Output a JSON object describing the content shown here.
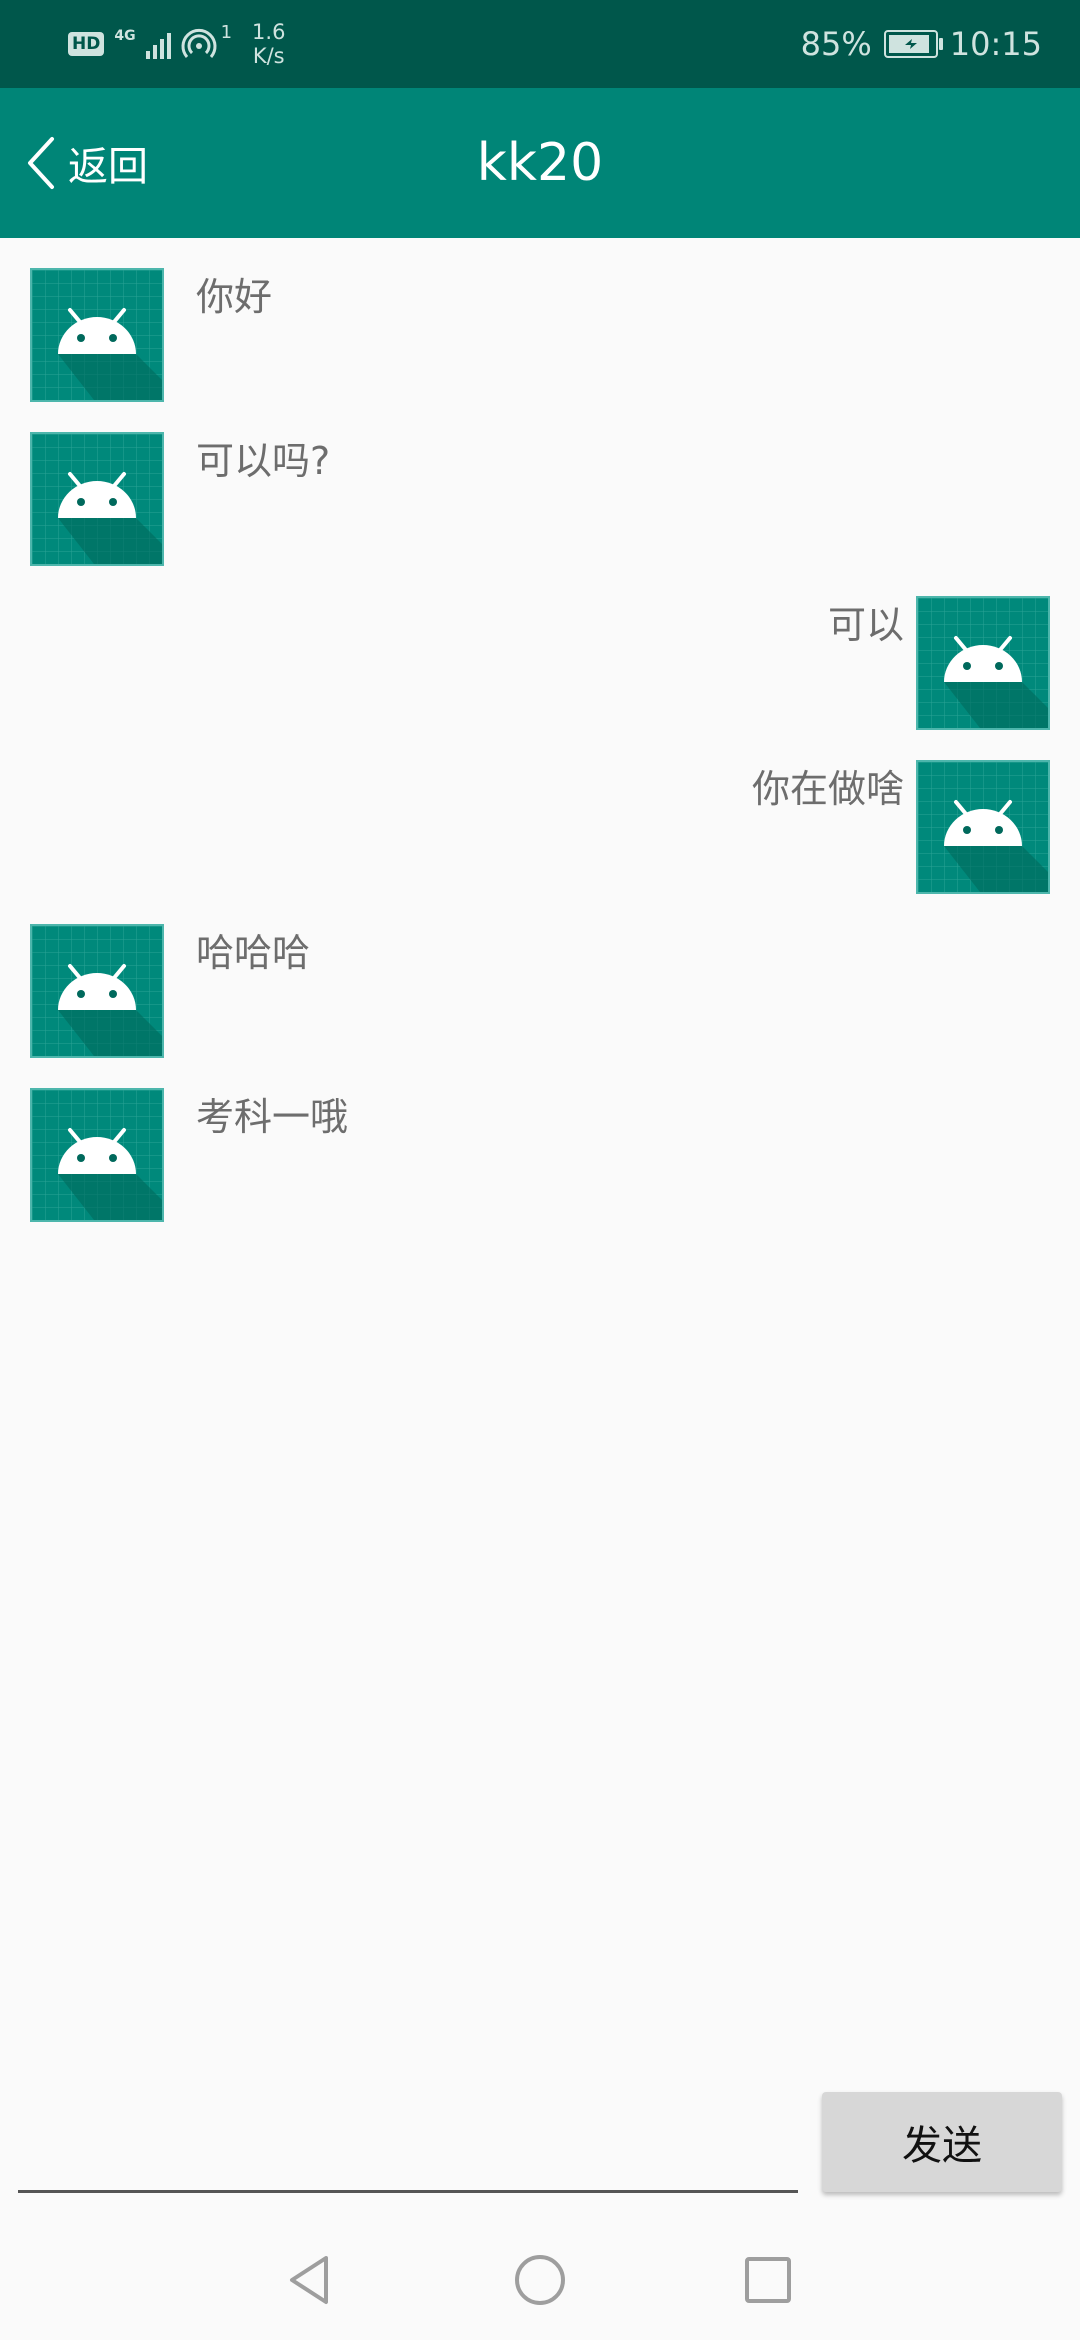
{
  "status_bar": {
    "hd": "HD",
    "network": "4G",
    "hotspot_count": "1",
    "speed_value": "1.6",
    "speed_unit": "K/s",
    "battery": "85%",
    "time": "10:15"
  },
  "app_bar": {
    "back_label": "返回",
    "title": "kk20"
  },
  "messages": [
    {
      "side": "left",
      "text": "你好"
    },
    {
      "side": "left",
      "text": "可以吗?"
    },
    {
      "side": "right",
      "text": "可以"
    },
    {
      "side": "right",
      "text": "你在做啥"
    },
    {
      "side": "left",
      "text": "哈哈哈"
    },
    {
      "side": "left",
      "text": "考科一哦"
    }
  ],
  "composer": {
    "input_value": "",
    "send_label": "发送"
  },
  "colors": {
    "status_bar": "#00574b",
    "app_bar": "#008577",
    "avatar": "#00897b"
  },
  "icons": {
    "back": "chevron-left-icon",
    "avatar": "android-robot-icon",
    "nav_back": "triangle-back-icon",
    "nav_home": "circle-home-icon",
    "nav_recents": "square-recents-icon"
  }
}
